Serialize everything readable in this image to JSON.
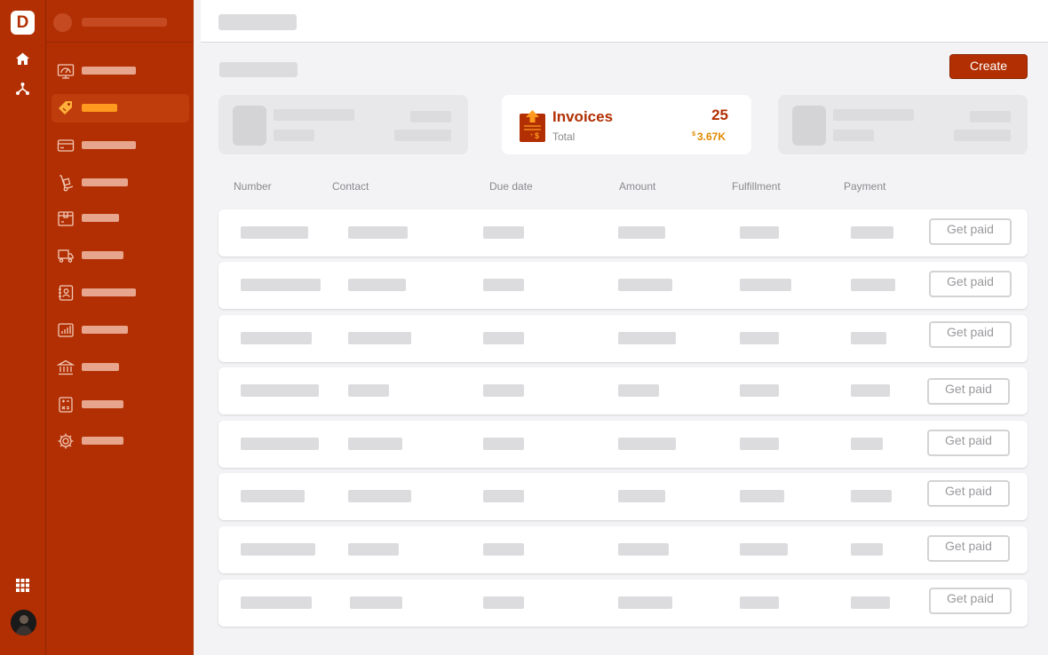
{
  "app": {
    "logo_letter": "D"
  },
  "rail": {
    "icons": [
      "home-icon",
      "network-icon"
    ],
    "bottom_icons": [
      "apps-grid-icon"
    ]
  },
  "sidebar": {
    "items": [
      {
        "icon": "dashboard-icon",
        "active": false
      },
      {
        "icon": "sales-tag-icon",
        "active": true
      },
      {
        "icon": "card-icon",
        "active": false
      },
      {
        "icon": "hand-truck-icon",
        "active": false
      },
      {
        "icon": "box-icon",
        "active": false
      },
      {
        "icon": "cart-icon",
        "active": false
      },
      {
        "icon": "contacts-icon",
        "active": false
      },
      {
        "icon": "reports-icon",
        "active": false
      },
      {
        "icon": "bank-icon",
        "active": false
      },
      {
        "icon": "calculator-icon",
        "active": false
      },
      {
        "icon": "settings-icon",
        "active": false
      }
    ]
  },
  "header": {
    "create_label": "Create"
  },
  "summary": {
    "title": "Invoices",
    "subtitle": "Total",
    "count": "25",
    "currency": "$",
    "amount": "3.67K"
  },
  "table": {
    "columns": [
      "Number",
      "Contact",
      "Due date",
      "Amount",
      "Fulfillment",
      "Payment"
    ],
    "action_label": "Get paid",
    "row_count": 8
  },
  "colors": {
    "brand": "#b12f02",
    "accent": "#ff9a1f",
    "amount": "#e08a00"
  }
}
